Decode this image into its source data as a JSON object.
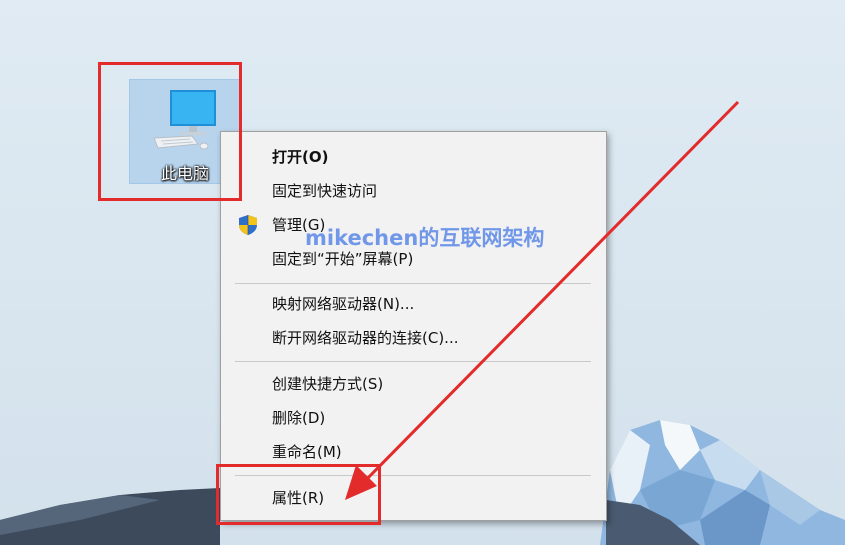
{
  "desktop": {
    "icon_label": "此电脑"
  },
  "context_menu": {
    "items": [
      {
        "label": "打开(O)",
        "bold": true
      },
      {
        "label": "固定到快速访问"
      },
      {
        "label": "管理(G)",
        "icon": "uac-shield-icon"
      },
      {
        "label": "固定到“开始”屏幕(P)"
      },
      {
        "label": "映射网络驱动器(N)..."
      },
      {
        "label": "断开网络驱动器的连接(C)..."
      },
      {
        "label": "创建快捷方式(S)"
      },
      {
        "label": "删除(D)"
      },
      {
        "label": "重命名(M)"
      },
      {
        "label": "属性(R)"
      }
    ]
  },
  "watermark": "mikechen的互联网架构",
  "colors": {
    "highlight": "#e32b2b",
    "arrow": "#e32b2b",
    "icon_selected_bg": "#b1d0ec",
    "watermark": "#4678e6"
  }
}
